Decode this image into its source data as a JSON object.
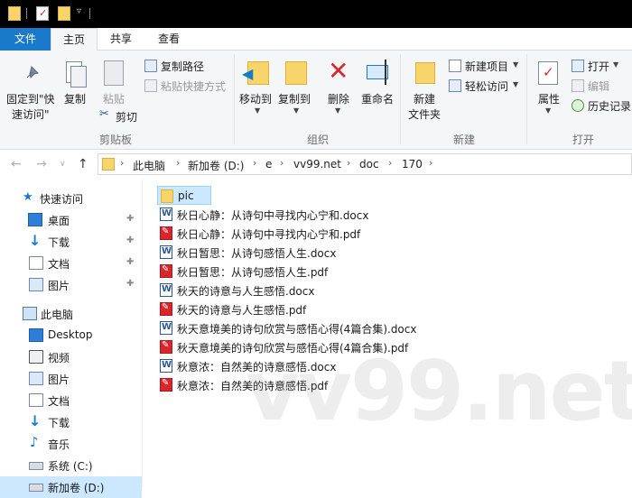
{
  "tabs": {
    "file": "文件",
    "home": "主页",
    "share": "共享",
    "view": "查看"
  },
  "ribbon": {
    "pin_quick": "固定到\"快",
    "pin_quick_2": "速访问\"",
    "copy": "复制",
    "paste": "粘贴",
    "copy_path": "复制路径",
    "paste_shortcut": "粘贴快捷方式",
    "cut": "剪切",
    "group_clipboard": "剪贴板",
    "move_to": "移动到",
    "copy_to": "复制到",
    "delete": "删除",
    "rename": "重命名",
    "group_organize": "组织",
    "new_folder_1": "新建",
    "new_folder_2": "文件夹",
    "new_item": "新建项目",
    "easy_access": "轻松访问",
    "group_new": "新建",
    "properties": "属性",
    "open": "打开",
    "edit": "编辑",
    "history": "历史记录",
    "group_open": "打开"
  },
  "breadcrumbs": [
    "此电脑",
    "新加卷 (D:)",
    "e",
    "vv99.net",
    "doc",
    "170"
  ],
  "nav": {
    "quick_access": "快速访问",
    "desktop": "桌面",
    "downloads": "下载",
    "documents": "文档",
    "pictures": "图片",
    "this_pc": "此电脑",
    "pc_desktop": "Desktop",
    "videos": "视频",
    "pc_pictures": "图片",
    "pc_documents": "文档",
    "pc_downloads": "下载",
    "music": "音乐",
    "system_c": "系统 (C:)",
    "new_volume_d": "新加卷 (D:)"
  },
  "files": [
    {
      "name": "pic",
      "type": "folder"
    },
    {
      "name": "秋日心静：从诗句中寻找内心宁和.docx",
      "type": "docx"
    },
    {
      "name": "秋日心静：从诗句中寻找内心宁和.pdf",
      "type": "pdf"
    },
    {
      "name": "秋日暂思：从诗句感悟人生.docx",
      "type": "docx"
    },
    {
      "name": "秋日暂思：从诗句感悟人生.pdf",
      "type": "pdf"
    },
    {
      "name": "秋天的诗意与人生感悟.docx",
      "type": "docx"
    },
    {
      "name": "秋天的诗意与人生感悟.pdf",
      "type": "pdf"
    },
    {
      "name": "秋天意境美的诗句欣赏与感悟心得(4篇合集).docx",
      "type": "docx"
    },
    {
      "name": "秋天意境美的诗句欣赏与感悟心得(4篇合集).pdf",
      "type": "pdf"
    },
    {
      "name": "秋意浓：自然美的诗意感悟.docx",
      "type": "docx"
    },
    {
      "name": "秋意浓：自然美的诗意感悟.pdf",
      "type": "pdf"
    }
  ],
  "watermark": "vv99.net",
  "colors": {
    "accent": "#1979ca",
    "selection": "#cce8ff",
    "folder": "#f7d56a",
    "pdf": "#d9262c",
    "word": "#2b5797"
  }
}
